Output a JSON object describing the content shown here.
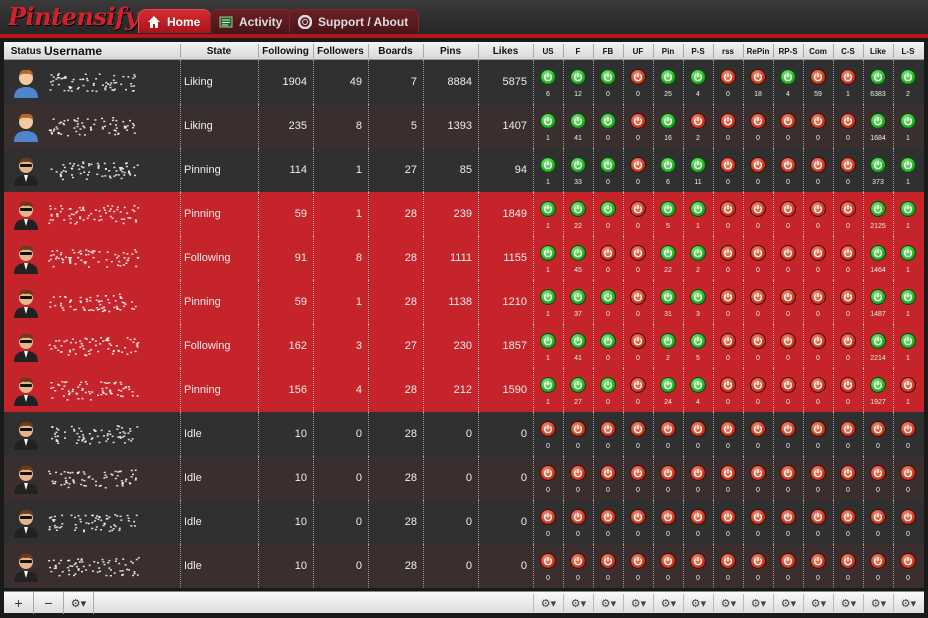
{
  "app": {
    "logo_text": "Pintensify"
  },
  "tabs": [
    {
      "label": "Home",
      "active": true,
      "icon": "home-icon"
    },
    {
      "label": "Activity",
      "active": false,
      "icon": "activity-icon"
    },
    {
      "label": "Support / About",
      "active": false,
      "icon": "support-icon"
    }
  ],
  "columns": {
    "status": "Status",
    "username": "Username",
    "state": "State",
    "following": "Following",
    "followers": "Followers",
    "boards": "Boards",
    "pins": "Pins",
    "likes": "Likes"
  },
  "toggle_columns": [
    "US",
    "F",
    "FB",
    "UF",
    "Pin",
    "P-S",
    "rss",
    "RePin",
    "RP-S",
    "Com",
    "C-S",
    "Like",
    "L-S"
  ],
  "colors": {
    "accent": "#c5242a",
    "on": "#23b223",
    "off": "#d2381c"
  },
  "rows": [
    {
      "avatar": "male-avatar",
      "highlight": false,
      "state": "Liking",
      "following": "1904",
      "followers": "49",
      "boards": "7",
      "pins": "8884",
      "likes": "5875",
      "toggles": [
        1,
        1,
        1,
        0,
        1,
        1,
        0,
        0,
        1,
        0,
        0,
        1,
        1
      ],
      "counts": [
        "6",
        "12",
        "0",
        "0",
        "25",
        "4",
        "0",
        "18",
        "4",
        "59",
        "1",
        "6383",
        "2"
      ]
    },
    {
      "avatar": "male-avatar",
      "highlight": false,
      "state": "Liking",
      "following": "235",
      "followers": "8",
      "boards": "5",
      "pins": "1393",
      "likes": "1407",
      "toggles": [
        1,
        1,
        1,
        0,
        1,
        0,
        0,
        0,
        0,
        0,
        0,
        1,
        1
      ],
      "counts": [
        "1",
        "41",
        "0",
        "0",
        "16",
        "2",
        "0",
        "0",
        "0",
        "0",
        "0",
        "1684",
        "1"
      ]
    },
    {
      "avatar": "agent-avatar",
      "highlight": false,
      "state": "Pinning",
      "following": "114",
      "followers": "1",
      "boards": "27",
      "pins": "85",
      "likes": "94",
      "toggles": [
        1,
        1,
        1,
        0,
        1,
        1,
        0,
        0,
        0,
        0,
        0,
        1,
        1
      ],
      "counts": [
        "1",
        "33",
        "0",
        "0",
        "6",
        "11",
        "0",
        "0",
        "0",
        "0",
        "0",
        "373",
        "1"
      ]
    },
    {
      "avatar": "agent-avatar",
      "highlight": true,
      "state": "Pinning",
      "following": "59",
      "followers": "1",
      "boards": "28",
      "pins": "239",
      "likes": "1849",
      "toggles": [
        1,
        1,
        1,
        0,
        1,
        1,
        0,
        0,
        0,
        0,
        0,
        1,
        1
      ],
      "counts": [
        "1",
        "22",
        "0",
        "0",
        "5",
        "1",
        "0",
        "0",
        "0",
        "0",
        "0",
        "2125",
        "1"
      ]
    },
    {
      "avatar": "agent-avatar",
      "highlight": true,
      "state": "Following",
      "following": "91",
      "followers": "8",
      "boards": "28",
      "pins": "1111",
      "likes": "1155",
      "toggles": [
        1,
        1,
        0,
        0,
        1,
        1,
        0,
        0,
        0,
        0,
        0,
        1,
        1
      ],
      "counts": [
        "1",
        "45",
        "0",
        "0",
        "22",
        "2",
        "0",
        "0",
        "0",
        "0",
        "0",
        "1464",
        "1"
      ]
    },
    {
      "avatar": "agent-avatar",
      "highlight": true,
      "state": "Pinning",
      "following": "59",
      "followers": "1",
      "boards": "28",
      "pins": "1138",
      "likes": "1210",
      "toggles": [
        1,
        1,
        1,
        0,
        1,
        1,
        0,
        0,
        0,
        0,
        0,
        1,
        1
      ],
      "counts": [
        "1",
        "37",
        "0",
        "0",
        "31",
        "3",
        "0",
        "0",
        "0",
        "0",
        "0",
        "1487",
        "1"
      ]
    },
    {
      "avatar": "agent-avatar",
      "highlight": true,
      "state": "Following",
      "following": "162",
      "followers": "3",
      "boards": "27",
      "pins": "230",
      "likes": "1857",
      "toggles": [
        1,
        1,
        1,
        0,
        1,
        1,
        0,
        0,
        0,
        0,
        0,
        1,
        1
      ],
      "counts": [
        "1",
        "41",
        "0",
        "0",
        "2",
        "5",
        "0",
        "0",
        "0",
        "0",
        "0",
        "2214",
        "1"
      ]
    },
    {
      "avatar": "agent-avatar",
      "highlight": true,
      "state": "Pinning",
      "following": "156",
      "followers": "4",
      "boards": "28",
      "pins": "212",
      "likes": "1590",
      "toggles": [
        1,
        1,
        1,
        0,
        1,
        1,
        0,
        0,
        0,
        0,
        0,
        1,
        0
      ],
      "counts": [
        "1",
        "27",
        "0",
        "0",
        "24",
        "4",
        "0",
        "0",
        "0",
        "0",
        "0",
        "1927",
        "1"
      ]
    },
    {
      "avatar": "agent-avatar",
      "highlight": false,
      "state": "Idle",
      "following": "10",
      "followers": "0",
      "boards": "28",
      "pins": "0",
      "likes": "0",
      "toggles": [
        0,
        0,
        0,
        0,
        0,
        0,
        0,
        0,
        0,
        0,
        0,
        0,
        0
      ],
      "counts": [
        "0",
        "0",
        "0",
        "0",
        "0",
        "0",
        "0",
        "0",
        "0",
        "0",
        "0",
        "0",
        "0"
      ]
    },
    {
      "avatar": "agent-avatar",
      "highlight": false,
      "state": "Idle",
      "following": "10",
      "followers": "0",
      "boards": "28",
      "pins": "0",
      "likes": "0",
      "toggles": [
        0,
        0,
        0,
        0,
        0,
        0,
        0,
        0,
        0,
        0,
        0,
        0,
        0
      ],
      "counts": [
        "0",
        "0",
        "0",
        "0",
        "0",
        "0",
        "0",
        "0",
        "0",
        "0",
        "0",
        "0",
        "0"
      ]
    },
    {
      "avatar": "agent-avatar",
      "highlight": false,
      "state": "Idle",
      "following": "10",
      "followers": "0",
      "boards": "28",
      "pins": "0",
      "likes": "0",
      "toggles": [
        0,
        0,
        0,
        0,
        0,
        0,
        0,
        0,
        0,
        0,
        0,
        0,
        0
      ],
      "counts": [
        "0",
        "0",
        "0",
        "0",
        "0",
        "0",
        "0",
        "0",
        "0",
        "0",
        "0",
        "0",
        "0"
      ]
    },
    {
      "avatar": "agent-avatar",
      "highlight": false,
      "state": "Idle",
      "following": "10",
      "followers": "0",
      "boards": "28",
      "pins": "0",
      "likes": "0",
      "toggles": [
        0,
        0,
        0,
        0,
        0,
        0,
        0,
        0,
        0,
        0,
        0,
        0,
        0
      ],
      "counts": [
        "0",
        "0",
        "0",
        "0",
        "0",
        "0",
        "0",
        "0",
        "0",
        "0",
        "0",
        "0",
        "0"
      ]
    }
  ],
  "footer": {
    "add_label": "+",
    "remove_label": "−",
    "gear_label": "⚙▾"
  }
}
